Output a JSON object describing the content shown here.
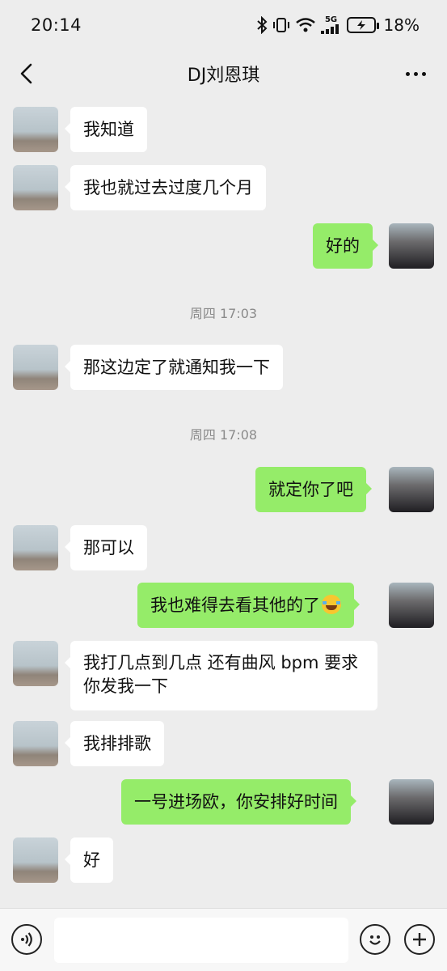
{
  "status_bar": {
    "time": "20:14",
    "battery_percent": "18%",
    "network_label": "5G",
    "icons": [
      "bluetooth-icon",
      "vibrate-icon",
      "wifi-icon",
      "signal-icon",
      "battery-charging-icon"
    ]
  },
  "header": {
    "title": "DJ刘恩琪",
    "back_icon": "chevron-left-icon",
    "more_icon": "more-dots-icon"
  },
  "messages": [
    {
      "side": "in",
      "text": "我知道"
    },
    {
      "side": "in",
      "text": "我也就过去过度几个月"
    },
    {
      "side": "out",
      "text": "好的"
    },
    {
      "type": "time",
      "text": "周四 17:03"
    },
    {
      "side": "in",
      "text": "那这边定了就通知我一下"
    },
    {
      "type": "time",
      "text": "周四 17:08"
    },
    {
      "side": "out",
      "text": "就定你了吧"
    },
    {
      "side": "in",
      "text": "那可以"
    },
    {
      "side": "out",
      "text": "我也难得去看其他的了",
      "emoji": "laugh-cry-emoji"
    },
    {
      "side": "in",
      "text": "我打几点到几点 还有曲风 bpm 要求你发我一下"
    },
    {
      "side": "in",
      "text": "我排排歌"
    },
    {
      "side": "out",
      "text": "一号进场欧，你安排好时间"
    },
    {
      "side": "in",
      "text": "好"
    }
  ],
  "input_bar": {
    "placeholder": "",
    "value": "",
    "icons": [
      "voice-icon",
      "emoji-face-icon",
      "plus-circle-icon"
    ]
  },
  "colors": {
    "background": "#ededed",
    "incoming_bubble": "#ffffff",
    "outgoing_bubble": "#95ec69"
  }
}
